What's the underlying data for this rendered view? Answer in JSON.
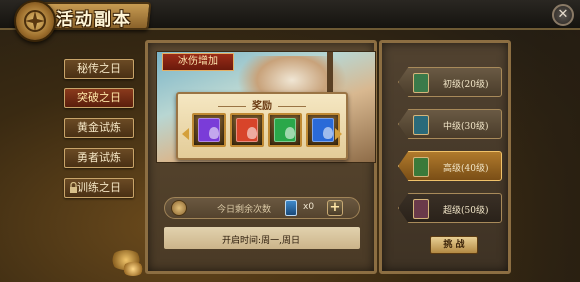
{
  "header": {
    "title": "活动副本",
    "close_symbol": "✕"
  },
  "sidebar": {
    "items": [
      {
        "label": "秘传之日",
        "active": false,
        "locked": false
      },
      {
        "label": "突破之日",
        "active": true,
        "locked": false
      },
      {
        "label": "黄金试炼",
        "active": false,
        "locked": false
      },
      {
        "label": "勇者试炼",
        "active": false,
        "locked": false
      },
      {
        "label": "训练之日",
        "active": false,
        "locked": true
      }
    ]
  },
  "main": {
    "tag": "冰伤增加",
    "reward_title": "奖励",
    "rewards": [
      {
        "name": "purple-book",
        "color": "#7a3cd8"
      },
      {
        "name": "red-book",
        "color": "#d8442a"
      },
      {
        "name": "green-book",
        "color": "#2aa84a"
      },
      {
        "name": "blue-book",
        "color": "#2a6ad8"
      }
    ],
    "attempts_label": "今日剩余次数",
    "attempts_count": "x0",
    "plus_symbol": "+",
    "open_time": "开启时间:周一,周日"
  },
  "difficulty": {
    "items": [
      {
        "label": "初级(20级)",
        "icon_color": "#3a7a4a",
        "state": "normal"
      },
      {
        "label": "中级(30级)",
        "icon_color": "#2a6a7a",
        "state": "normal"
      },
      {
        "label": "高级(40级)",
        "icon_color": "#3a7a3a",
        "state": "active"
      },
      {
        "label": "超级(50级)",
        "icon_color": "#6a3a4a",
        "state": "locked"
      }
    ],
    "challenge_label": "挑 战"
  }
}
